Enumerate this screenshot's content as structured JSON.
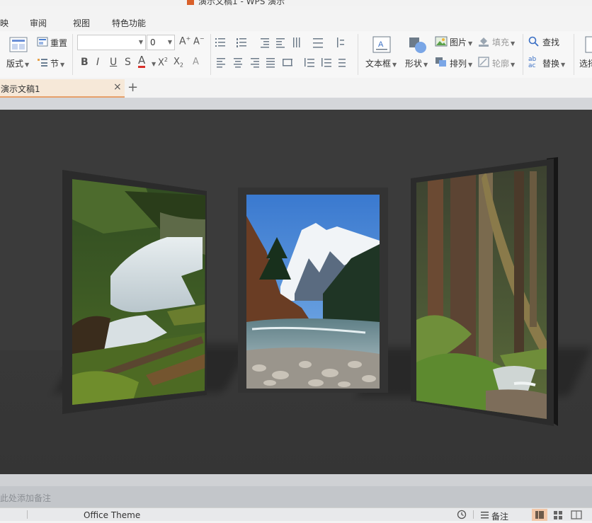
{
  "window": {
    "title": "演示文稿1 - WPS 演示"
  },
  "menu": {
    "tabs": [
      "映",
      "审阅",
      "视图",
      "特色功能"
    ]
  },
  "ribbon": {
    "layout_label": "版式",
    "reset_label": "重置",
    "section_label": "节",
    "font_name_value": "",
    "font_size_value": "0",
    "textbox_label": "文本框",
    "shape_label": "形状",
    "picture_label": "图片",
    "arrange_label": "排列",
    "fill_label": "填充",
    "outline_label": "轮廓",
    "find_label": "查找",
    "replace_label": "替换",
    "select_label": "选择"
  },
  "doc_tabs": [
    {
      "label": "演示文稿1",
      "active": true
    }
  ],
  "notes": {
    "placeholder": "单击此处添加备注"
  },
  "status": {
    "theme": "Office Theme",
    "notes_button": "备注"
  },
  "colors": {
    "slide_background": "#3b3b3b",
    "workspace": "#d4d6da",
    "active_tab": "#f6e8d8",
    "accent_orange": "#e6a06a"
  },
  "slide_images": [
    {
      "subject": "waterfall in mossy forest"
    },
    {
      "subject": "snowy mountain above river"
    },
    {
      "subject": "forest with ferns and small stream"
    }
  ]
}
